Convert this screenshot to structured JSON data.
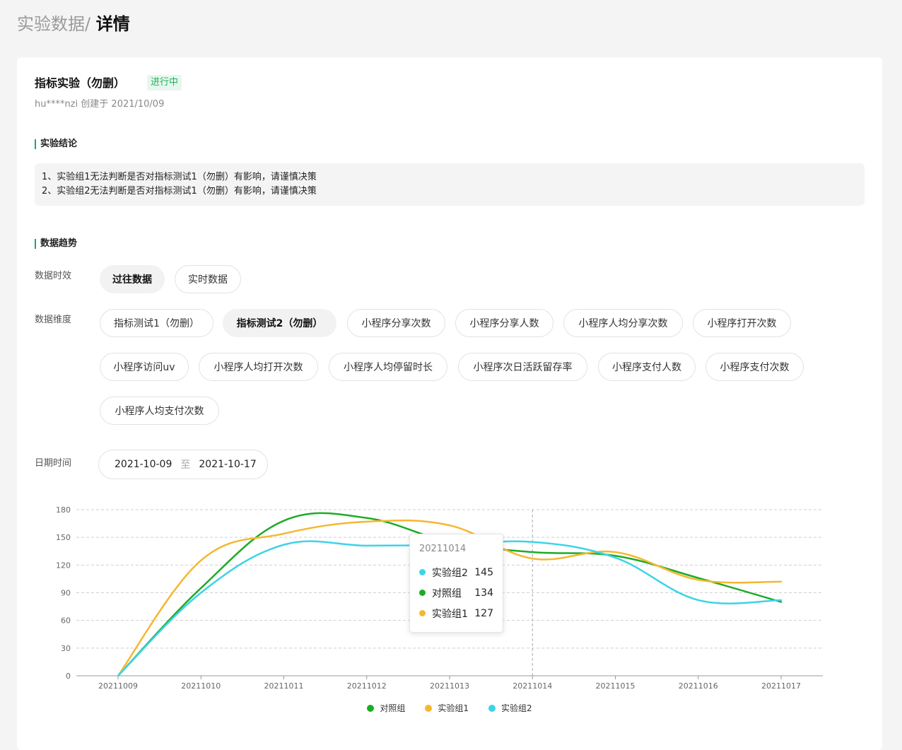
{
  "breadcrumb": {
    "parent": "实验数据/",
    "current": "详情"
  },
  "experiment": {
    "title": "指标实验（勿删）",
    "status": "进行中",
    "meta": "hu****nzi 创建于 2021/10/09"
  },
  "conclusion": {
    "title": "实验结论",
    "lines": [
      "1、实验组1无法判断是否对指标测试1（勿删）有影响，请谨慎决策",
      "2、实验组2无法判断是否对指标测试1（勿删）有影响，请谨慎决策"
    ]
  },
  "trend": {
    "title": "数据趋势",
    "timeliness_label": "数据时效",
    "timeliness_options": [
      "过往数据",
      "实时数据"
    ],
    "timeliness_selected": 0,
    "dimension_label": "数据维度",
    "dimension_options": [
      "指标测试1（勿删）",
      "指标测试2（勿删）",
      "小程序分享次数",
      "小程序分享人数",
      "小程序人均分享次数",
      "小程序打开次数",
      "小程序访问uv",
      "小程序人均打开次数",
      "小程序人均停留时长",
      "小程序次日活跃留存率",
      "小程序支付人数",
      "小程序支付次数",
      "小程序人均支付次数"
    ],
    "dimension_selected": 1,
    "date_label": "日期时间",
    "date_start": "2021-10-09",
    "date_sep": "至",
    "date_end": "2021-10-17"
  },
  "chart_data": {
    "type": "line",
    "categories": [
      "20211009",
      "20211010",
      "20211011",
      "20211012",
      "20211013",
      "20211014",
      "20211015",
      "20211016",
      "20211017"
    ],
    "yticks": [
      "0",
      "30",
      "60",
      "90",
      "120",
      "150",
      "180"
    ],
    "ylim": [
      0,
      180
    ],
    "grid": true,
    "legend_position": "bottom",
    "series": [
      {
        "name": "对照组",
        "color": "#1fab26",
        "values": [
          0,
          95,
          168,
          171,
          145,
          134,
          130,
          106,
          80
        ]
      },
      {
        "name": "实验组1",
        "color": "#f5b731",
        "values": [
          0,
          125,
          154,
          167,
          163,
          127,
          134,
          104,
          102
        ]
      },
      {
        "name": "实验组2",
        "color": "#3dd3e8",
        "values": [
          0,
          90,
          142,
          141,
          142,
          145,
          128,
          82,
          82
        ]
      }
    ],
    "tooltip": {
      "title": "20211014",
      "rows": [
        {
          "name": "实验组2",
          "value": "145",
          "color": "#3dd3e8"
        },
        {
          "name": "对照组",
          "value": "134",
          "color": "#1fab26"
        },
        {
          "name": "实验组1",
          "value": "127",
          "color": "#f5b731"
        }
      ]
    }
  }
}
